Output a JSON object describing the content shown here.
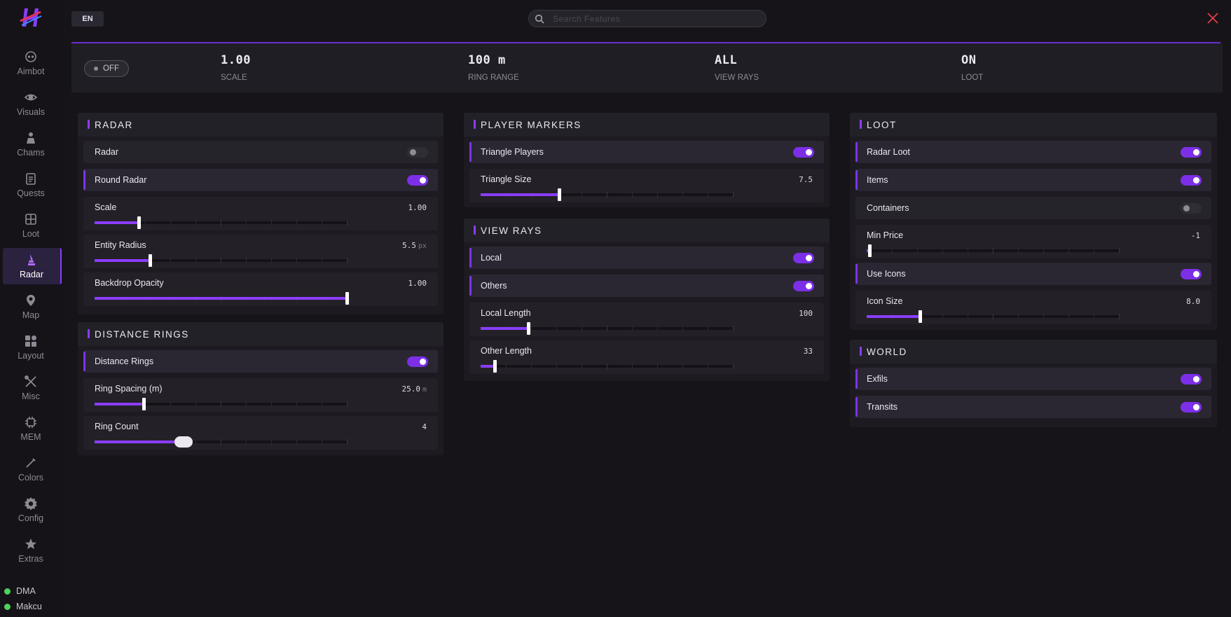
{
  "colors": {
    "accent": "#8b3dff",
    "background": "#161419",
    "status_ok": "#4ed25a",
    "close": "#e0404a"
  },
  "topbar": {
    "language": "EN",
    "search_placeholder": "Search Features"
  },
  "sidebar": {
    "items": [
      {
        "label": "Aimbot",
        "icon": "crosshair-face-icon"
      },
      {
        "label": "Visuals",
        "icon": "eye-icon"
      },
      {
        "label": "Chams",
        "icon": "person-icon"
      },
      {
        "label": "Quests",
        "icon": "clipboard-icon"
      },
      {
        "label": "Loot",
        "icon": "box-icon"
      },
      {
        "label": "Radar",
        "icon": "radar-icon",
        "active": true
      },
      {
        "label": "Map",
        "icon": "map-pin-icon"
      },
      {
        "label": "Layout",
        "icon": "layout-icon"
      },
      {
        "label": "Misc",
        "icon": "tools-icon"
      },
      {
        "label": "MEM",
        "icon": "chip-icon"
      },
      {
        "label": "Colors",
        "icon": "pen-icon"
      },
      {
        "label": "Config",
        "icon": "gear-icon"
      },
      {
        "label": "Extras",
        "icon": "star-icon"
      }
    ],
    "status": [
      {
        "label": "DMA"
      },
      {
        "label": "Makcu"
      }
    ]
  },
  "stats": {
    "toggle_label": "OFF",
    "items": [
      {
        "value": "1.00",
        "label": "SCALE"
      },
      {
        "value": "100 m",
        "label": "RING RANGE"
      },
      {
        "value": "ALL",
        "label": "VIEW RAYS"
      },
      {
        "value": "ON",
        "label": "LOOT"
      }
    ]
  },
  "radar": {
    "title": "RADAR",
    "radar_toggle": {
      "label": "Radar",
      "on": false
    },
    "round_radar": {
      "label": "Round Radar",
      "on": true
    },
    "scale": {
      "label": "Scale",
      "value": "1.00",
      "unit": "",
      "fraction": 0.175
    },
    "entity_radius": {
      "label": "Entity Radius",
      "value": "5.5",
      "unit": "px",
      "fraction": 0.22
    },
    "backdrop_opacity": {
      "label": "Backdrop Opacity",
      "value": "1.00",
      "unit": "",
      "fraction": 1.0
    }
  },
  "distance_rings": {
    "title": "DISTANCE RINGS",
    "rings_toggle": {
      "label": "Distance Rings",
      "on": true
    },
    "ring_spacing": {
      "label": "Ring Spacing (m)",
      "value": "25.0",
      "unit": "m",
      "fraction": 0.195
    },
    "ring_count": {
      "label": "Ring Count",
      "value": "4",
      "unit": "",
      "fraction": 0.34
    }
  },
  "player_markers": {
    "title": "PLAYER MARKERS",
    "triangle_players": {
      "label": "Triangle Players",
      "on": true
    },
    "triangle_size": {
      "label": "Triangle Size",
      "value": "7.5",
      "unit": "",
      "fraction": 0.31
    }
  },
  "view_rays": {
    "title": "VIEW RAYS",
    "local": {
      "label": "Local",
      "on": true
    },
    "others": {
      "label": "Others",
      "on": true
    },
    "local_length": {
      "label": "Local Length",
      "value": "100",
      "unit": "",
      "fraction": 0.19
    },
    "other_length": {
      "label": "Other Length",
      "value": "33",
      "unit": "",
      "fraction": 0.055
    }
  },
  "loot": {
    "title": "LOOT",
    "radar_loot": {
      "label": "Radar Loot",
      "on": true
    },
    "items": {
      "label": "Items",
      "on": true
    },
    "containers": {
      "label": "Containers",
      "on": false
    },
    "min_price": {
      "label": "Min Price",
      "value": "-1",
      "unit": "",
      "fraction": 0.01
    },
    "use_icons": {
      "label": "Use Icons",
      "on": true
    },
    "icon_size": {
      "label": "Icon Size",
      "value": "8.0",
      "unit": "",
      "fraction": 0.21
    }
  },
  "world": {
    "title": "WORLD",
    "exfils": {
      "label": "Exfils",
      "on": true
    },
    "transits": {
      "label": "Transits",
      "on": true
    }
  }
}
